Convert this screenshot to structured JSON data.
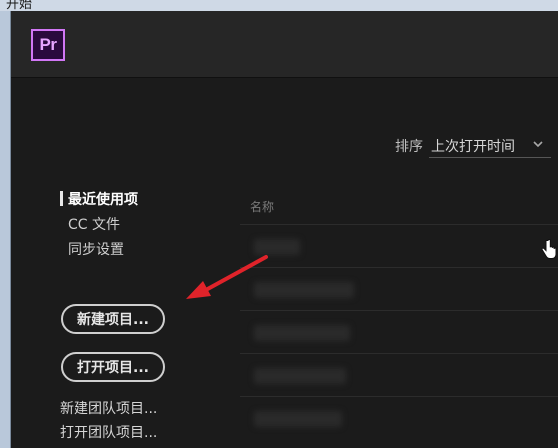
{
  "window": {
    "title": "开始"
  },
  "header": {
    "logo_text": "Pr"
  },
  "sort": {
    "label": "排序",
    "value": "上次打开时间",
    "icon": "chevron-down-icon"
  },
  "nav": [
    {
      "label": "最近使用项",
      "active": true
    },
    {
      "label": "CC 文件",
      "active": false
    },
    {
      "label": "同步设置",
      "active": false
    }
  ],
  "buttons": {
    "new_project": "新建项目...",
    "open_project": "打开项目..."
  },
  "links": {
    "new_team_project": "新建团队项目...",
    "open_team_project": "打开团队项目..."
  },
  "recent_list": {
    "column_name": "名称"
  },
  "colors": {
    "accent": "#d177f5",
    "annotation_arrow": "#e0232a"
  }
}
